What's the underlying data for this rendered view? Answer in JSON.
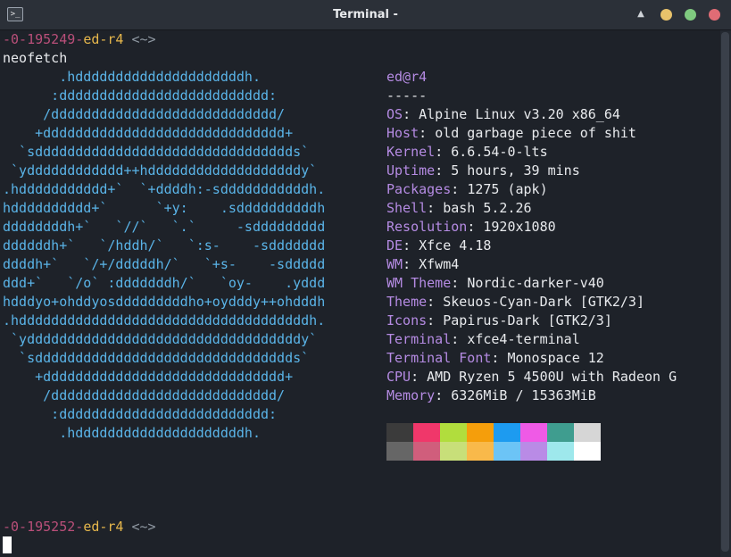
{
  "window": {
    "title": "Terminal -",
    "icon_label": ">_",
    "controls": {
      "up_arrow": "▲",
      "minimize_color": "#e8c26b",
      "maximize_color": "#7fc97f",
      "close_color": "#e06c75"
    }
  },
  "prompt1": {
    "num": "-0-195249-",
    "host": "ed-r4",
    "dir": " <~>"
  },
  "command": "neofetch",
  "art": [
    "       .hdddddddddddddddddddddh.",
    "      :dddddddddddddddddddddddddd:",
    "     /dddddddddddddddddddddddddddd/",
    "    +dddddddddddddddddddddddddddddd+",
    "  `sdddddddddddddddddddddddddddddddds`",
    " `ydddddddddddd++hdddddddddddddddddddy`",
    ".hddddddddddd+`  `+ddddh:-sdddddddddddh.",
    "hdddddddddd+`      `+y:    .sddddddddddh",
    "ddddddddh+`   `//`   `.`     -sddddddddd",
    "ddddddh+`   `/hddh/`   `:s-    -sddddddd",
    "ddddh+`   `/+/dddddh/`   `+s-    -sddddd",
    "ddd+`   `/o` :dddddddh/`   `oy-    .yddd",
    "hdddyo+ohddyosdddddddddho+oydddy++ohdddh",
    ".hddddddddddddddddddddddddddddddddddddh.",
    " `yddddddddddddddddddddddddddddddddddy`",
    "  `sdddddddddddddddddddddddddddddddds`",
    "    +dddddddddddddddddddddddddddddd+",
    "     /dddddddddddddddddddddddddddd/",
    "      :dddddddddddddddddddddddddd:",
    "       .hdddddddddddddddddddddh."
  ],
  "info": {
    "userhost": "ed@r4",
    "separator": "-----",
    "rows": [
      {
        "key": "OS",
        "value": "Alpine Linux v3.20 x86_64"
      },
      {
        "key": "Host",
        "value": "old garbage piece of shit"
      },
      {
        "key": "Kernel",
        "value": "6.6.54-0-lts"
      },
      {
        "key": "Uptime",
        "value": "5 hours, 39 mins"
      },
      {
        "key": "Packages",
        "value": "1275 (apk)"
      },
      {
        "key": "Shell",
        "value": "bash 5.2.26"
      },
      {
        "key": "Resolution",
        "value": "1920x1080"
      },
      {
        "key": "DE",
        "value": "Xfce 4.18"
      },
      {
        "key": "WM",
        "value": "Xfwm4"
      },
      {
        "key": "WM Theme",
        "value": "Nordic-darker-v40"
      },
      {
        "key": "Theme",
        "value": "Skeuos-Cyan-Dark [GTK2/3]"
      },
      {
        "key": "Icons",
        "value": "Papirus-Dark [GTK2/3]"
      },
      {
        "key": "Terminal",
        "value": "xfce4-terminal"
      },
      {
        "key": "Terminal Font",
        "value": "Monospace 12"
      },
      {
        "key": "CPU",
        "value": "AMD Ryzen 5 4500U with Radeon G"
      },
      {
        "key": "Memory",
        "value": "6326MiB / 15363MiB"
      }
    ]
  },
  "palette": {
    "normal": [
      "#3b3b3b",
      "#f0376a",
      "#b1dd3d",
      "#f59e0b",
      "#1d9bf0",
      "#ef5ae6",
      "#3f9d8f",
      "#d6d6d6"
    ],
    "bright": [
      "#666666",
      "#d05e7c",
      "#c8df79",
      "#f9b94a",
      "#6cc4f6",
      "#b98be6",
      "#9ee8ec",
      "#ffffff"
    ]
  },
  "prompt2": {
    "num": "-0-195252-",
    "host": "ed-r4",
    "dir": " <~>"
  }
}
